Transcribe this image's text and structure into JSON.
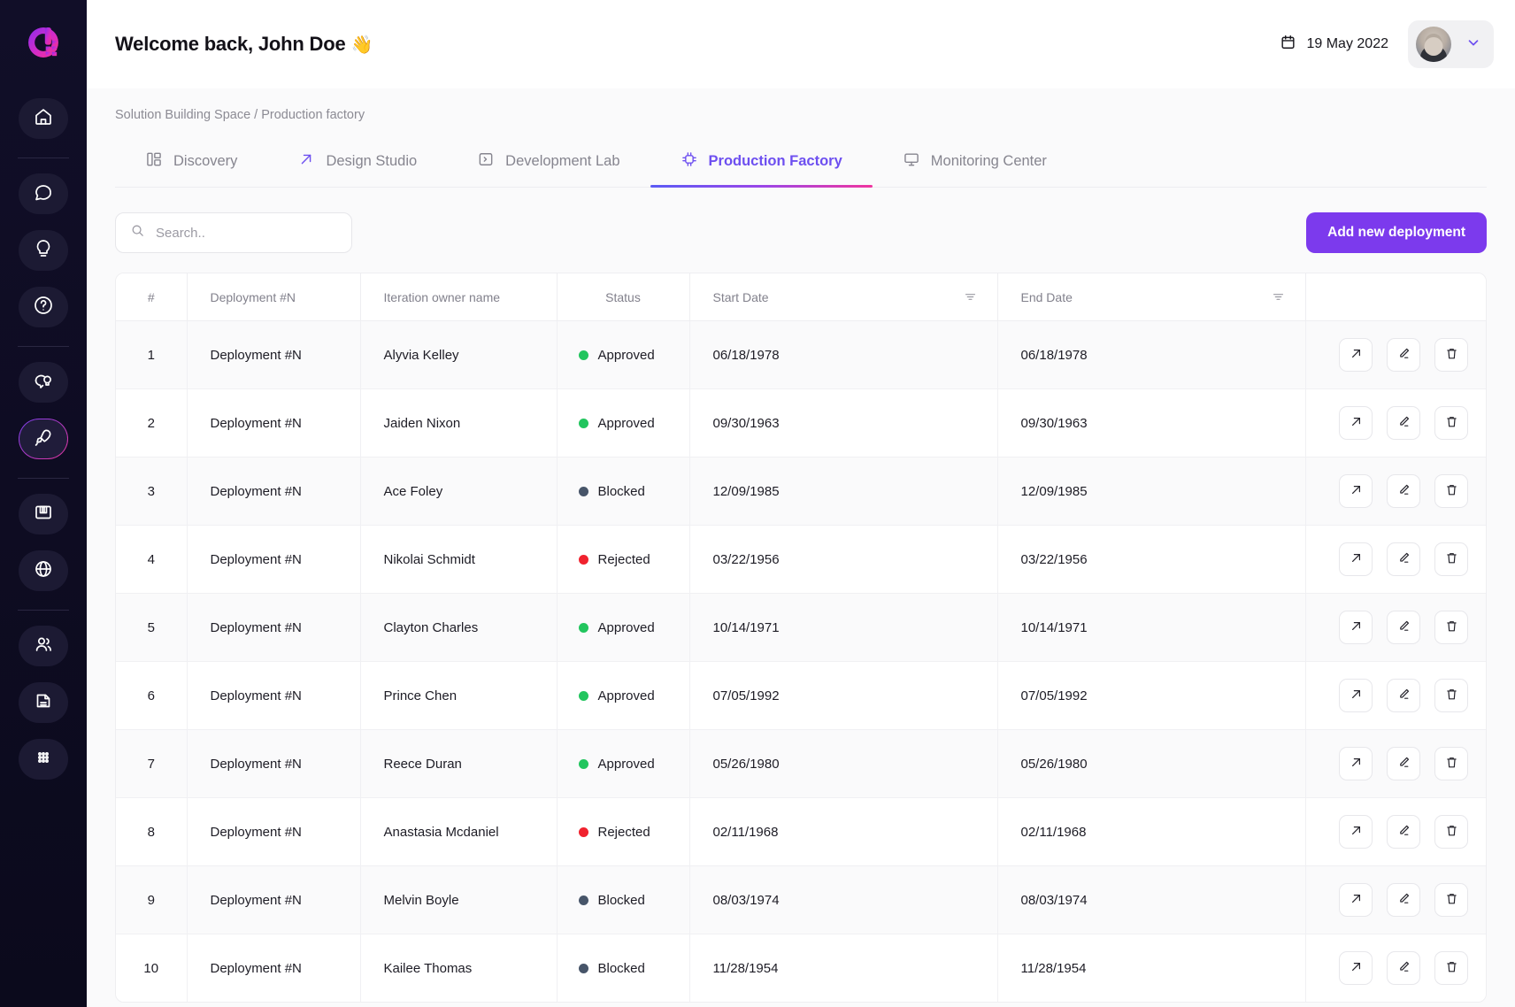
{
  "sidebar": {
    "logo_name": "brand-logo",
    "items": [
      {
        "name": "home",
        "label": "Home",
        "active": false
      },
      {
        "name": "chat",
        "label": "Chat",
        "active": false
      },
      {
        "name": "idea",
        "label": "Ideas",
        "active": false
      },
      {
        "name": "help",
        "label": "Help",
        "active": false
      },
      {
        "name": "insight",
        "label": "Insights",
        "active": false
      },
      {
        "name": "rocket",
        "label": "Production",
        "active": true
      },
      {
        "name": "archive",
        "label": "Archive",
        "active": false
      },
      {
        "name": "globe",
        "label": "Global",
        "active": false
      },
      {
        "name": "users",
        "label": "Team",
        "active": false
      },
      {
        "name": "document",
        "label": "Documents",
        "active": false
      },
      {
        "name": "apps",
        "label": "Apps",
        "active": false
      }
    ]
  },
  "header": {
    "greeting": "Welcome back, John Doe",
    "wave_emoji": "👋",
    "date": "19 May 2022",
    "calendar_icon": "calendar-icon",
    "avatar_icon": "user-avatar",
    "chevron_icon": "chevron-down-icon"
  },
  "breadcrumb": {
    "root": "Solution Building Space",
    "separator": "/",
    "current": "Production factory"
  },
  "tabs": [
    {
      "label": "Discovery",
      "icon": "layout-grid-icon",
      "active": false,
      "accent_icon": false
    },
    {
      "label": "Design Studio",
      "icon": "arrow-up-right-icon",
      "active": false,
      "accent_icon": true
    },
    {
      "label": "Development Lab",
      "icon": "terminal-icon",
      "active": false,
      "accent_icon": false
    },
    {
      "label": "Production Factory",
      "icon": "cpu-chip-icon",
      "active": true,
      "accent_icon": false
    },
    {
      "label": "Monitoring Center",
      "icon": "monitor-icon",
      "active": false,
      "accent_icon": false
    }
  ],
  "toolbar": {
    "search_placeholder": "Search..",
    "search_value": "",
    "search_icon": "search-icon",
    "add_button_label": "Add new deployment",
    "add_button_color": "#7c3aed"
  },
  "table": {
    "columns": [
      {
        "key": "index",
        "label": "#",
        "filter": false
      },
      {
        "key": "name",
        "label": "Deployment #N",
        "filter": false
      },
      {
        "key": "owner",
        "label": "Iteration owner name",
        "filter": false
      },
      {
        "key": "status",
        "label": "Status",
        "filter": false
      },
      {
        "key": "start",
        "label": "Start Date",
        "filter": true
      },
      {
        "key": "end",
        "label": "End Date",
        "filter": true
      },
      {
        "key": "actions",
        "label": "",
        "filter": false
      }
    ],
    "status_colors": {
      "Approved": "#22c55e",
      "Blocked": "#475569",
      "Rejected": "#f0222e"
    },
    "row_actions": [
      {
        "name": "open-row-button",
        "icon": "arrow-up-right-icon"
      },
      {
        "name": "edit-row-button",
        "icon": "pencil-icon"
      },
      {
        "name": "delete-row-button",
        "icon": "trash-icon"
      }
    ],
    "rows": [
      {
        "index": "1",
        "name": "Deployment #N",
        "owner": "Alyvia Kelley",
        "status": "Approved",
        "start": "06/18/1978",
        "end": "06/18/1978"
      },
      {
        "index": "2",
        "name": "Deployment #N",
        "owner": "Jaiden Nixon",
        "status": "Approved",
        "start": "09/30/1963",
        "end": "09/30/1963"
      },
      {
        "index": "3",
        "name": "Deployment #N",
        "owner": "Ace Foley",
        "status": "Blocked",
        "start": "12/09/1985",
        "end": "12/09/1985"
      },
      {
        "index": "4",
        "name": "Deployment #N",
        "owner": "Nikolai Schmidt",
        "status": "Rejected",
        "start": "03/22/1956",
        "end": "03/22/1956"
      },
      {
        "index": "5",
        "name": "Deployment #N",
        "owner": "Clayton Charles",
        "status": "Approved",
        "start": "10/14/1971",
        "end": "10/14/1971"
      },
      {
        "index": "6",
        "name": "Deployment #N",
        "owner": "Prince Chen",
        "status": "Approved",
        "start": "07/05/1992",
        "end": "07/05/1992"
      },
      {
        "index": "7",
        "name": "Deployment #N",
        "owner": "Reece Duran",
        "status": "Approved",
        "start": "05/26/1980",
        "end": "05/26/1980"
      },
      {
        "index": "8",
        "name": "Deployment #N",
        "owner": "Anastasia Mcdaniel",
        "status": "Rejected",
        "start": "02/11/1968",
        "end": "02/11/1968"
      },
      {
        "index": "9",
        "name": "Deployment #N",
        "owner": "Melvin Boyle",
        "status": "Blocked",
        "start": "08/03/1974",
        "end": "08/03/1974"
      },
      {
        "index": "10",
        "name": "Deployment #N",
        "owner": "Kailee Thomas",
        "status": "Blocked",
        "start": "11/28/1954",
        "end": "11/28/1954"
      }
    ]
  }
}
